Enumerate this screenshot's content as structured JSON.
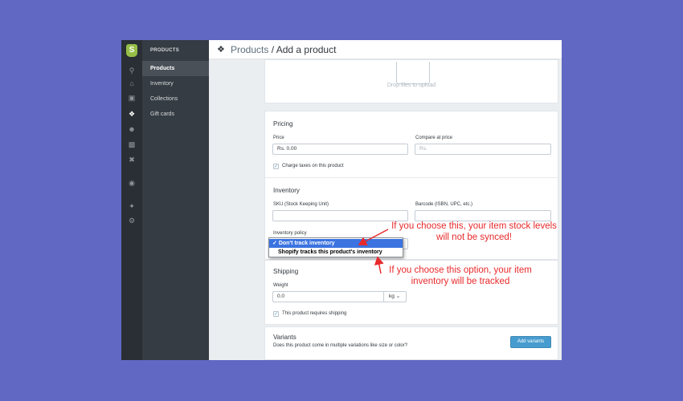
{
  "rail": {
    "icons": [
      "shopify-logo",
      "search-icon",
      "home-icon",
      "orders-icon",
      "products-tag-icon",
      "customers-icon",
      "reports-icon",
      "discounts-icon",
      "sales-channel-icon",
      "apps-icon",
      "settings-icon"
    ]
  },
  "subnav": {
    "title": "PRODUCTS",
    "items": [
      {
        "label": "Products",
        "active": true
      },
      {
        "label": "Inventory",
        "active": false
      },
      {
        "label": "Collections",
        "active": false
      },
      {
        "label": "Gift cards",
        "active": false
      }
    ]
  },
  "breadcrumb": {
    "parent": "Products",
    "separator": " / ",
    "current": "Add a product"
  },
  "images": {
    "drop_text": "Drop files to upload"
  },
  "pricing": {
    "title": "Pricing",
    "price_label": "Price",
    "price_value": "Rs. 0.00",
    "compare_label": "Compare at price",
    "compare_placeholder": "Rs.",
    "charge_taxes_label": "Charge taxes on this product",
    "charge_taxes_checked": true
  },
  "inventory": {
    "title": "Inventory",
    "sku_label": "SKU (Stock Keeping Unit)",
    "barcode_label": "Barcode (ISBN, UPC, etc.)",
    "policy_label": "Inventory policy",
    "options": [
      {
        "label": "Don't track inventory",
        "selected": true,
        "check": "✓"
      },
      {
        "label": "Shopify tracks this product's inventory",
        "selected": false
      }
    ]
  },
  "shipping": {
    "title": "Shipping",
    "weight_label": "Weight",
    "weight_value": "0.0",
    "unit": "kg",
    "requires_shipping_label": "This product requires shipping",
    "requires_shipping_checked": true
  },
  "variants": {
    "title": "Variants",
    "description": "Does this product come in multiple variations like size or color?",
    "button_label": "Add variants"
  },
  "annotations": {
    "top_line1": "If you choose this, your item stock levels",
    "top_line2": "will not be synced!",
    "bottom_line1": "If you choose this option, your item",
    "bottom_line2": "inventory will be tracked"
  },
  "colors": {
    "background": "#6068c4",
    "rail": "#2a2f35",
    "subnav": "#363c43",
    "accent": "#479ccf",
    "annotation": "#e8292b",
    "selected_option": "#3b73e0"
  }
}
